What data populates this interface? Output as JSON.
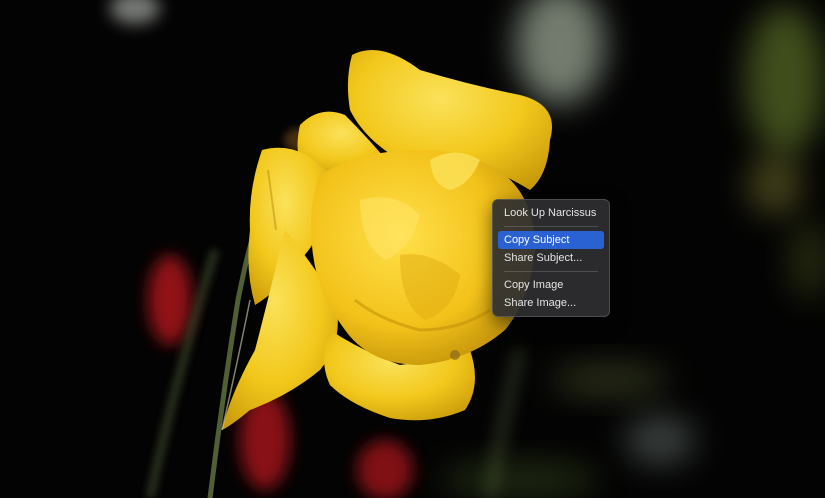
{
  "photo": {
    "subject": "narcissus-flower",
    "colors": {
      "background": "#030303",
      "petal": "#f2c81c",
      "petal_highlight": "#fbe25a",
      "stem": "#5a6a3a",
      "red_blooms": "#b5141c",
      "leaf_green": "#6b8f2a"
    }
  },
  "context_menu": {
    "items": [
      {
        "label": "Look Up Narcissus",
        "selected": false
      },
      {
        "label": "Copy Subject",
        "selected": true
      },
      {
        "label": "Share Subject...",
        "selected": false
      },
      {
        "label": "Copy Image",
        "selected": false
      },
      {
        "label": "Share Image...",
        "selected": false
      }
    ],
    "colors": {
      "menu_bg": "#2e2e30",
      "highlight": "#2a62d4",
      "text": "#e4e4e4"
    }
  }
}
